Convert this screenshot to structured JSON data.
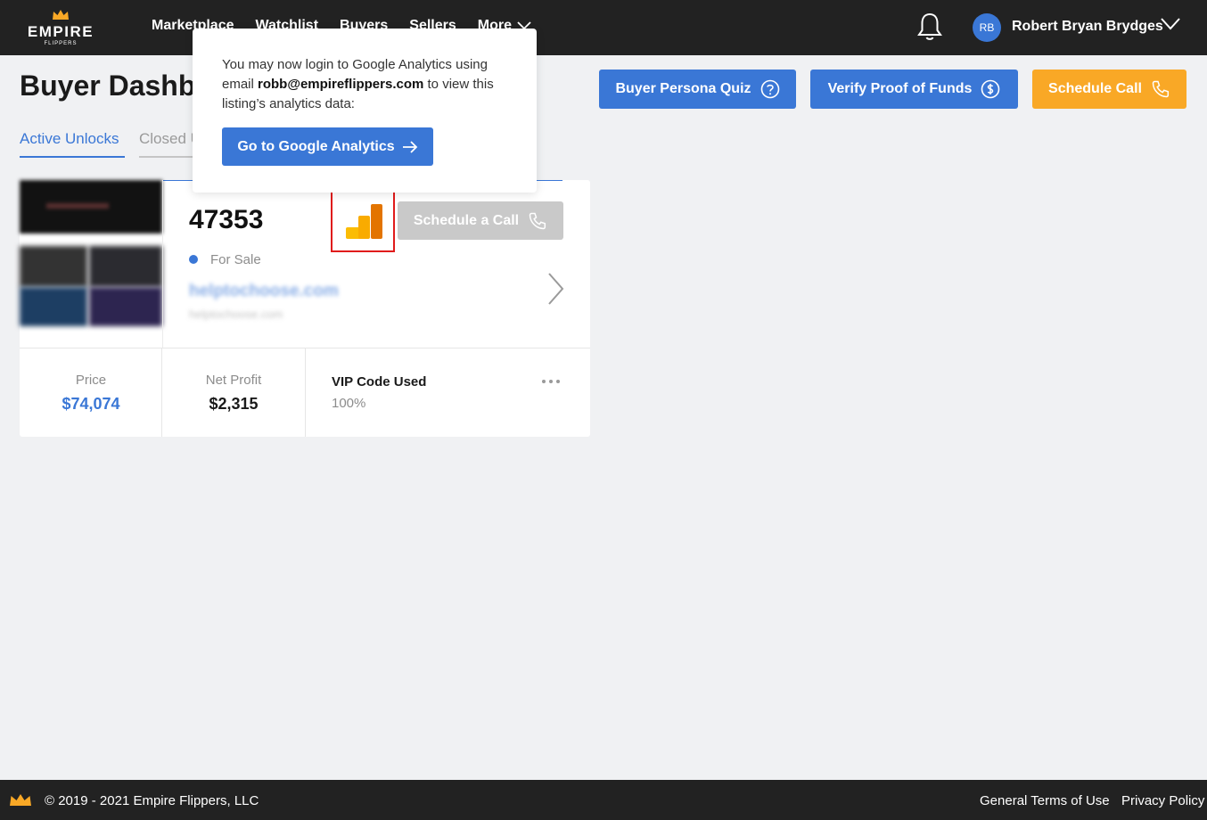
{
  "brand": {
    "name": "EMPIRE",
    "tagline": "FLIPPERS",
    "accent": "#f9a826",
    "primary": "#3a77d6"
  },
  "nav": {
    "links": [
      "Marketplace",
      "Watchlist",
      "Buyers",
      "Sellers",
      "More"
    ],
    "user_initials": "RB",
    "user_name": "Robert Bryan Brydges"
  },
  "page": {
    "title": "Buyer Dashboard"
  },
  "header_buttons": {
    "quiz": "Buyer Persona Quiz",
    "funds": "Verify Proof of Funds",
    "call": "Schedule Call"
  },
  "tabs": {
    "active": "Active Unlocks",
    "closed": "Closed Unlocks"
  },
  "listing": {
    "id": "47353",
    "status": "For Sale",
    "site": "helptochoose.com",
    "site_sub": "helptochoose.com",
    "schedule_btn": "Schedule a Call",
    "price_label": "Price",
    "price_value": "$74,074",
    "profit_label": "Net Profit",
    "profit_value": "$2,315",
    "vip_label": "VIP Code Used",
    "vip_value": "100%"
  },
  "popup": {
    "text_before": "You may now login to Google Analytics using email ",
    "email": "robb@empireflippers.com",
    "text_after": " to view this listing’s analytics data:",
    "button": "Go to Google Analytics"
  },
  "footer": {
    "copyright": "© 2019 - 2021 Empire Flippers, LLC",
    "terms": "General Terms of Use",
    "privacy": "Privacy Policy"
  }
}
